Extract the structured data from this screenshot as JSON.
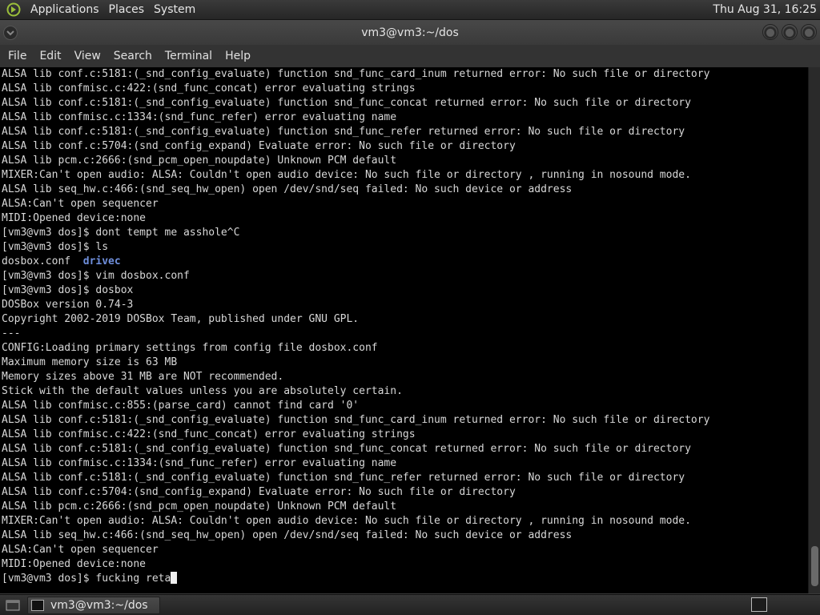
{
  "top_panel": {
    "menus": [
      "Applications",
      "Places",
      "System"
    ],
    "clock": "Thu Aug 31, 16:25"
  },
  "window": {
    "title": "vm3@vm3:~/dos",
    "menus": [
      "File",
      "Edit",
      "View",
      "Search",
      "Terminal",
      "Help"
    ]
  },
  "terminal": {
    "lines": [
      "ALSA lib conf.c:5181:(_snd_config_evaluate) function snd_func_card_inum returned error: No such file or directory",
      "ALSA lib confmisc.c:422:(snd_func_concat) error evaluating strings",
      "ALSA lib conf.c:5181:(_snd_config_evaluate) function snd_func_concat returned error: No such file or directory",
      "ALSA lib confmisc.c:1334:(snd_func_refer) error evaluating name",
      "ALSA lib conf.c:5181:(_snd_config_evaluate) function snd_func_refer returned error: No such file or directory",
      "ALSA lib conf.c:5704:(snd_config_expand) Evaluate error: No such file or directory",
      "ALSA lib pcm.c:2666:(snd_pcm_open_noupdate) Unknown PCM default",
      "MIXER:Can't open audio: ALSA: Couldn't open audio device: No such file or directory , running in nosound mode.",
      "ALSA lib seq_hw.c:466:(snd_seq_hw_open) open /dev/snd/seq failed: No such device or address",
      "ALSA:Can't open sequencer",
      "MIDI:Opened device:none",
      "[vm3@vm3 dos]$ dont tempt me asshole^C",
      "[vm3@vm3 dos]$ ls"
    ],
    "ls_file": "dosbox.conf",
    "ls_dir": "drivec",
    "lines2": [
      "[vm3@vm3 dos]$ vim dosbox.conf",
      "[vm3@vm3 dos]$ dosbox",
      "DOSBox version 0.74-3",
      "Copyright 2002-2019 DOSBox Team, published under GNU GPL.",
      "---",
      "CONFIG:Loading primary settings from config file dosbox.conf",
      "Maximum memory size is 63 MB",
      "Memory sizes above 31 MB are NOT recommended.",
      "Stick with the default values unless you are absolutely certain.",
      "ALSA lib confmisc.c:855:(parse_card) cannot find card '0'",
      "ALSA lib conf.c:5181:(_snd_config_evaluate) function snd_func_card_inum returned error: No such file or directory",
      "ALSA lib confmisc.c:422:(snd_func_concat) error evaluating strings",
      "ALSA lib conf.c:5181:(_snd_config_evaluate) function snd_func_concat returned error: No such file or directory",
      "ALSA lib confmisc.c:1334:(snd_func_refer) error evaluating name",
      "ALSA lib conf.c:5181:(_snd_config_evaluate) function snd_func_refer returned error: No such file or directory",
      "ALSA lib conf.c:5704:(snd_config_expand) Evaluate error: No such file or directory",
      "ALSA lib pcm.c:2666:(snd_pcm_open_noupdate) Unknown PCM default",
      "MIXER:Can't open audio: ALSA: Couldn't open audio device: No such file or directory , running in nosound mode.",
      "ALSA lib seq_hw.c:466:(snd_seq_hw_open) open /dev/snd/seq failed: No such device or address",
      "ALSA:Can't open sequencer",
      "MIDI:Opened device:none"
    ],
    "prompt_line": "[vm3@vm3 dos]$ fucking reta"
  },
  "taskbar": {
    "task_label": "vm3@vm3:~/dos"
  },
  "colors": {
    "directory": "#6f8fdc",
    "terminal_bg": "#000000",
    "terminal_fg": "#d8d8d8"
  }
}
